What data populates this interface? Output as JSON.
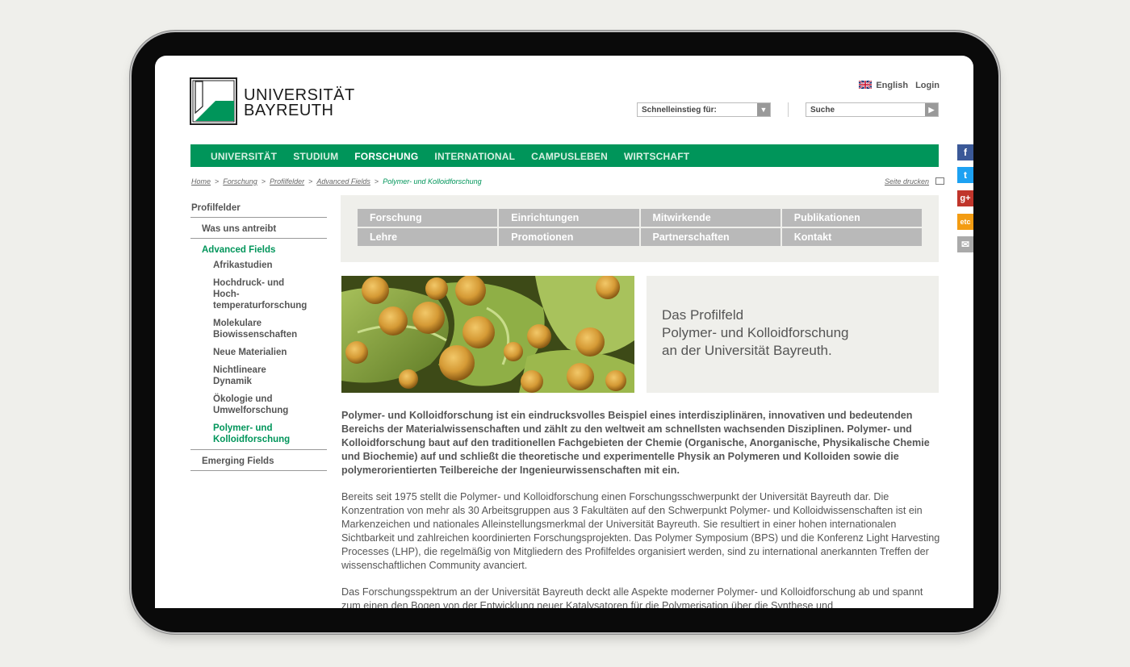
{
  "header": {
    "logo_line1": "UNIVERSITÄT",
    "logo_line2": "BAYREUTH",
    "lang_label": "English",
    "login_label": "Login",
    "quick_access_label": "Schnelleinstieg für:",
    "search_placeholder": "Suche"
  },
  "mainnav": [
    "UNIVERSITÄT",
    "STUDIUM",
    "FORSCHUNG",
    "INTERNATIONAL",
    "CAMPUSLEBEN",
    "WIRTSCHAFT"
  ],
  "mainnav_active": "FORSCHUNG",
  "breadcrumb": [
    "Home",
    "Forschung",
    "Profilfelder",
    "Advanced Fields",
    "Polymer- und Kolloidforschung"
  ],
  "breadcrumb_sep": ">",
  "print_label": "Seite drucken",
  "sidebar": {
    "root": "Profilfelder",
    "items": [
      {
        "label": "Was uns antreibt",
        "level": 1
      },
      {
        "label": "Advanced Fields",
        "level": 1,
        "active": true
      },
      {
        "label": "Afrikastudien",
        "level": 2
      },
      {
        "label": "Hochdruck- und Hoch-\ntemperaturforschung",
        "level": 2
      },
      {
        "label": "Molekulare\nBiowissenschaften",
        "level": 2
      },
      {
        "label": "Neue Materialien",
        "level": 2
      },
      {
        "label": "Nichtlineare Dynamik",
        "level": 2
      },
      {
        "label": "Ökologie und\nUmwelforschung",
        "level": 2
      },
      {
        "label": "Polymer- und\nKolloidforschung",
        "level": 2,
        "active": true
      },
      {
        "label": "Emerging Fields",
        "level": 1
      }
    ]
  },
  "subnav": [
    "Forschung",
    "Einrichtungen",
    "Mitwirkende",
    "Publikationen",
    "Lehre",
    "Promotionen",
    "Partnerschaften",
    "Kontakt"
  ],
  "hero": {
    "line1": "Das Profilfeld",
    "line2": "Polymer- und Kolloidforschung",
    "line3": "an der Universität Bayreuth."
  },
  "lead": "Polymer- und Kolloidforschung ist ein eindrucksvolles Beispiel eines interdisziplinären, innovativen und bedeutenden Bereichs der Materialwissenschaften und zählt zu den weltweit am schnellsten wachsenden Disziplinen. Polymer- und Kolloidforschung baut auf den traditionellen Fachgebieten der Chemie (Organische, Anorganische, Physikalische Chemie und Biochemie) auf und schließt die theoretische und experimentelle Physik an Polymeren und Kolloiden sowie die polymerorientierten Teilbereiche der Ingenieurwissenschaften mit ein.",
  "para1": "Bereits seit 1975 stellt die Polymer- und Kolloidforschung einen Forschungsschwerpunkt der Universität Bayreuth dar. Die Konzentration von mehr als 30 Arbeitsgruppen aus 3 Fakultäten auf den Schwerpunkt Polymer- und Kolloidwissenschaften ist ein Markenzeichen und nationales Alleinstellungsmerkmal der Universität Bayreuth. Sie resultiert in einer hohen internationalen Sichtbarkeit und zahlreichen koordinierten Forschungsprojekten. Das Polymer Symposium (BPS) und die Konferenz Light Harvesting Processes (LHP), die regelmäßig von Mitgliedern des Profilfeldes organisiert werden, sind zu international anerkannten Treffen der wissenschaftlichen Community avanciert.",
  "para2": "Das Forschungsspektrum an der Universität Bayreuth deckt alle Aspekte moderner Polymer- und Kolloidforschung ab und spannt zum einen den Bogen von der Entwicklung neuer Katalysatoren für die Polymerisation über die Synthese und",
  "social": [
    {
      "icon": "facebook-icon",
      "glyph": "f",
      "color": "#3b5998"
    },
    {
      "icon": "twitter-icon",
      "glyph": "t",
      "color": "#1da1f2"
    },
    {
      "icon": "google-plus-icon",
      "glyph": "g+",
      "color": "#c0352b"
    },
    {
      "icon": "etc-icon",
      "glyph": "etc",
      "color": "#f39c12"
    },
    {
      "icon": "mail-icon",
      "glyph": "✉",
      "color": "#aaaaaa"
    }
  ]
}
